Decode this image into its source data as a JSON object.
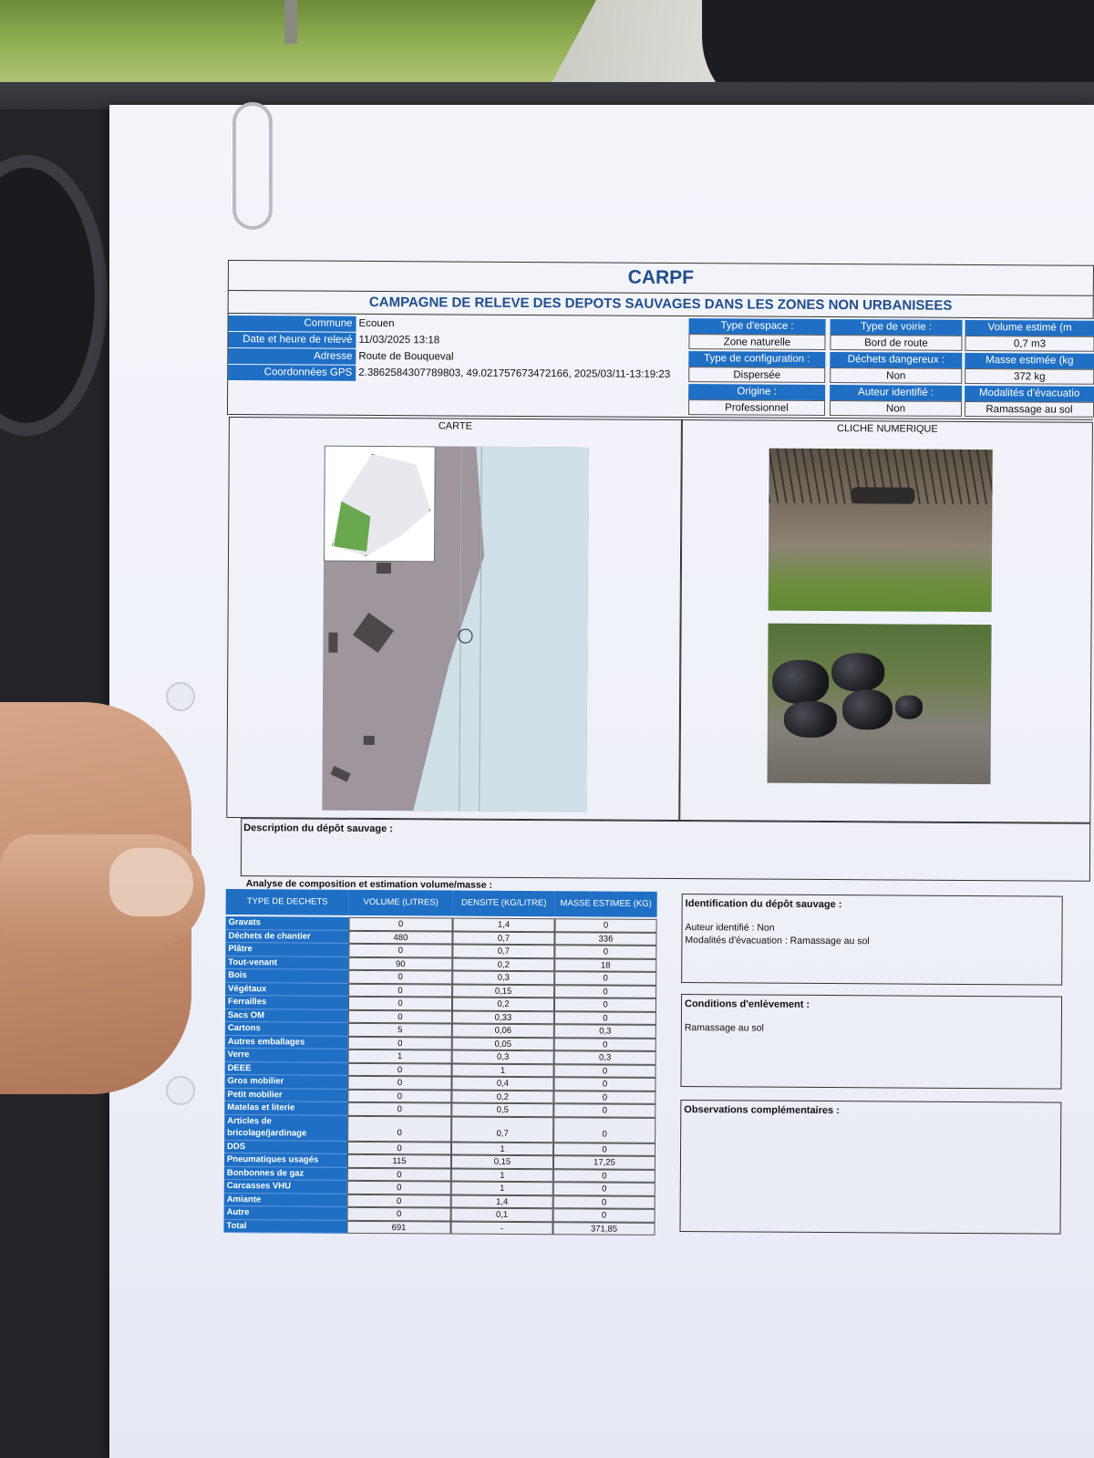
{
  "header": {
    "title": "CARPF",
    "subtitle": "CAMPAGNE DE RELEVE DES DEPOTS SAUVAGES DANS LES ZONES NON URBANISEES"
  },
  "info": {
    "commune_label": "Commune",
    "commune": "Ecouen",
    "date_label": "Date et heure de relevé",
    "date": "11/03/2025 13:18",
    "adresse_label": "Adresse",
    "adresse": "Route de Bouqueval",
    "gps_label": "Coordonnées GPS",
    "gps": "2.3862584307789803, 49.021757673472166, 2025/03/11-13:19:23"
  },
  "attributes": {
    "type_espace_label": "Type d'espace :",
    "type_espace": "Zone naturelle",
    "type_voirie_label": "Type de voirie :",
    "type_voirie": "Bord de route",
    "volume_label": "Volume estimé (m",
    "volume": "0,7 m3",
    "config_label": "Type de configuration :",
    "config": "Dispersée",
    "dangereux_label": "Déchets dangereux :",
    "dangereux": "Non",
    "masse_label": "Masse estimée (kg",
    "masse": "372 kg",
    "origine_label": "Origine :",
    "origine": "Professionnel",
    "auteur_label": "Auteur identifié :",
    "auteur": "Non",
    "modalites_label": "Modalités d'évacuatio",
    "modalites": "Ramassage au sol"
  },
  "sections": {
    "carte": "CARTE",
    "cliche": "CLICHE NUMERIQUE",
    "description": "Description du dépôt sauvage :",
    "analyse": "Analyse de composition et estimation volume/masse :"
  },
  "composition": {
    "headers": [
      "TYPE DE DECHETS",
      "VOLUME (LITRES)",
      "DENSITE (KG/LITRE)",
      "MASSE ESTIMEE (KG)"
    ],
    "rows": [
      [
        "Gravats",
        "0",
        "1,4",
        "0"
      ],
      [
        "Déchets de chantier",
        "480",
        "0,7",
        "336"
      ],
      [
        "Plâtre",
        "0",
        "0,7",
        "0"
      ],
      [
        "Tout-venant",
        "90",
        "0,2",
        "18"
      ],
      [
        "Bois",
        "0",
        "0,3",
        "0"
      ],
      [
        "Végétaux",
        "0",
        "0,15",
        "0"
      ],
      [
        "Ferrailles",
        "0",
        "0,2",
        "0"
      ],
      [
        "Sacs OM",
        "0",
        "0,33",
        "0"
      ],
      [
        "Cartons",
        "5",
        "0,06",
        "0,3"
      ],
      [
        "Autres emballages",
        "0",
        "0,05",
        "0"
      ],
      [
        "Verre",
        "1",
        "0,3",
        "0,3"
      ],
      [
        "DEEE",
        "0",
        "1",
        "0"
      ],
      [
        "Gros mobilier",
        "0",
        "0,4",
        "0"
      ],
      [
        "Petit mobilier",
        "0",
        "0,2",
        "0"
      ],
      [
        "Matelas et literie",
        "0",
        "0,5",
        "0"
      ],
      [
        "Articles de bricolage/jardinage",
        "0",
        "0,7",
        "0"
      ],
      [
        "DDS",
        "0",
        "1",
        "0"
      ],
      [
        "Pneumatiques usagés",
        "115",
        "0,15",
        "17,25"
      ],
      [
        "Bonbonnes de gaz",
        "0",
        "1",
        "0"
      ],
      [
        "Carcasses VHU",
        "0",
        "1",
        "0"
      ],
      [
        "Amiante",
        "0",
        "1,4",
        "0"
      ],
      [
        "Autre",
        "0",
        "0,1",
        "0"
      ],
      [
        "Total",
        "691",
        "-",
        "371,85"
      ]
    ]
  },
  "identification": {
    "title": "Identification du dépôt sauvage :",
    "auteur": "Auteur identifié : Non",
    "modalites": "Modalités d'évacuation :  Ramassage au sol"
  },
  "conditions": {
    "title": "Conditions d'enlèvement :",
    "text": "Ramassage au sol"
  },
  "observations": {
    "title": "Observations complémentaires :"
  },
  "colors": {
    "header_blue": "#1f6fc5",
    "title_blue": "#1f4e8c"
  }
}
